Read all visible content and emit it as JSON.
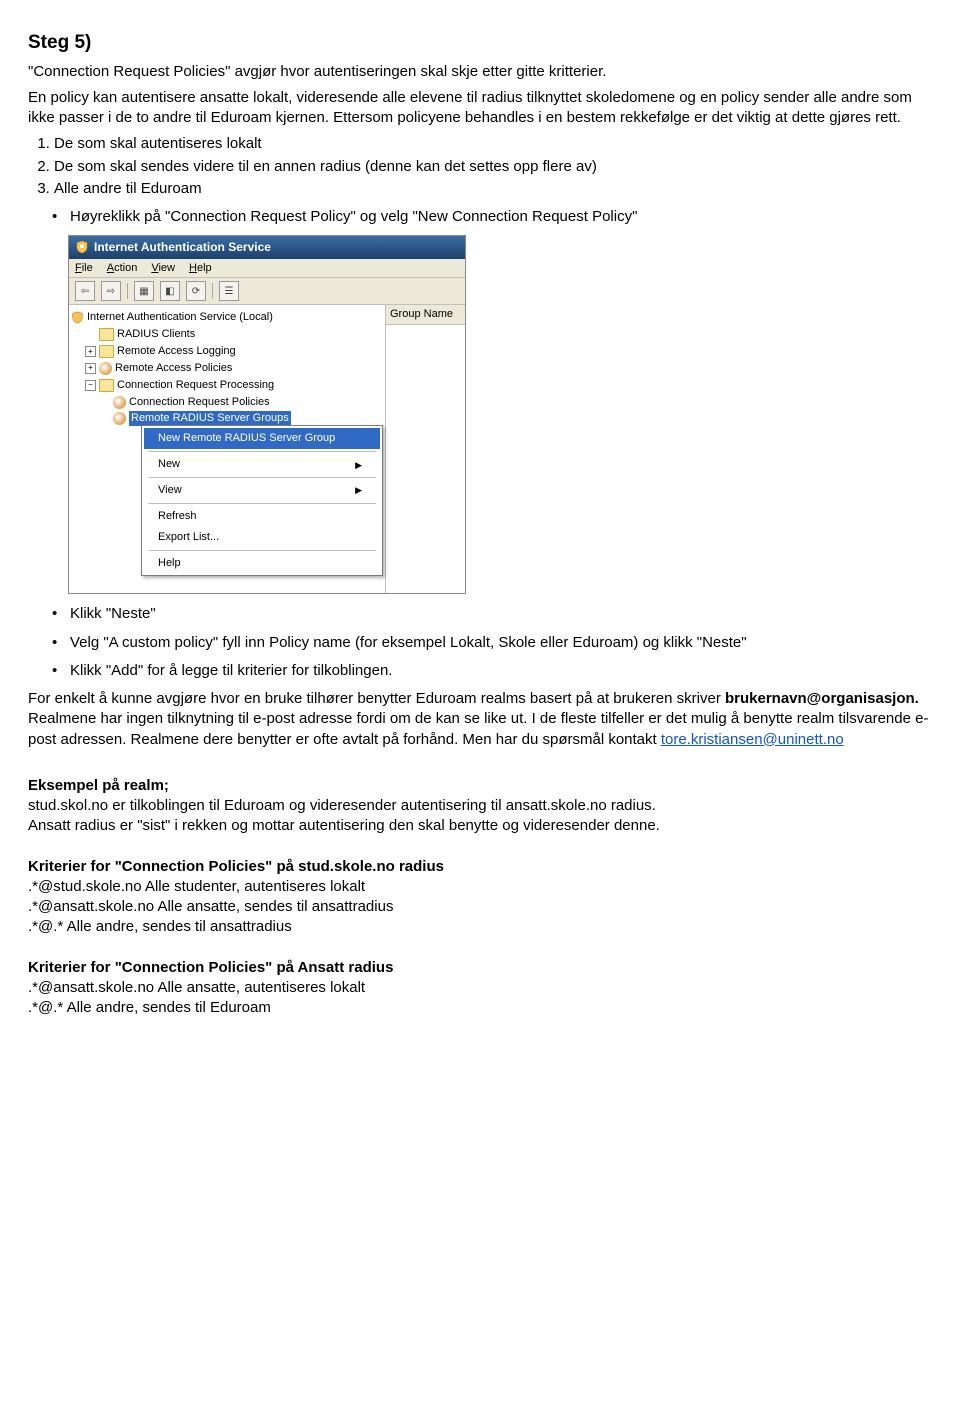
{
  "heading": "Steg 5)",
  "intro1": "\"Connection Request Policies\" avgjør hvor autentiseringen skal skje etter gitte kritterier.",
  "intro2": "En policy kan autentisere ansatte lokalt, videresende alle elevene til radius tilknyttet skoledomene og en policy sender alle andre som ikke passer i de to andre til Eduroam kjernen. Ettersom policyene behandles i en bestem rekkefølge er det viktig at dette gjøres rett.",
  "numbered": [
    "De som skal autentiseres lokalt",
    "De som skal sendes videre til en annen radius (denne kan det settes opp flere av)",
    "Alle andre til Eduroam"
  ],
  "bullet_top": "Høyreklikk på \"Connection Request Policy\" og velg \"New Connection Request Policy\"",
  "screenshot": {
    "title": "Internet Authentication Service",
    "menubar": {
      "file": "File",
      "action": "Action",
      "view": "View",
      "help": "Help"
    },
    "right_header": "Group Name",
    "tree": {
      "root": "Internet Authentication Service (Local)",
      "n1": "RADIUS Clients",
      "n2": "Remote Access Logging",
      "n3": "Remote Access Policies",
      "n4": "Connection Request Processing",
      "n5": "Connection Request Policies",
      "n6": "Remote RADIUS Server Groups"
    },
    "ctx": {
      "i1": "New Remote RADIUS Server Group",
      "i2": "New",
      "i3": "View",
      "i4": "Refresh",
      "i5": "Export List...",
      "i6": "Help"
    }
  },
  "bullets_after": {
    "b1": "Klikk \"Neste\"",
    "b2": "Velg \"A custom policy\" fyll inn Policy name (for eksempel Lokalt, Skole eller Eduroam) og klikk \"Neste\"",
    "b3": "Klikk \"Add\" for å legge til kriterier for tilkoblingen."
  },
  "para_realm1a": "For enkelt å kunne avgjøre hvor en bruke tilhører benytter Eduroam realms basert på at brukeren skriver ",
  "para_realm1b": "brukernavn@organisasjon.",
  "para_realm1c": " Realmene har ingen tilknytning til e-post adresse fordi om de kan se like ut. I de fleste tilfeller er det mulig å benytte realm tilsvarende e-post adressen. Realmene dere benytter er ofte avtalt på forhånd. Men har du spørsmål kontakt ",
  "email": "tore.kristiansen@uninett.no",
  "example_head": "Eksempel på realm;",
  "example_p1": "stud.skol.no er tilkoblingen til Eduroam og videresender autentisering til ansatt.skole.no radius.",
  "example_p2": "Ansatt radius er \"sist\" i rekken og mottar autentisering den skal benytte og videresender denne.",
  "crit1_head": "Kriterier for \"Connection Policies\" på stud.skole.no radius",
  "crit1_l1": ".*@stud.skole.no Alle studenter, autentiseres lokalt",
  "crit1_l2": ".*@ansatt.skole.no Alle ansatte, sendes til ansattradius",
  "crit1_l3": ".*@.* Alle andre, sendes til ansattradius",
  "crit2_head": "Kriterier for \"Connection Policies\" på Ansatt radius",
  "crit2_l1": ".*@ansatt.skole.no Alle ansatte, autentiseres lokalt",
  "crit2_l2": ".*@.* Alle andre, sendes til Eduroam"
}
